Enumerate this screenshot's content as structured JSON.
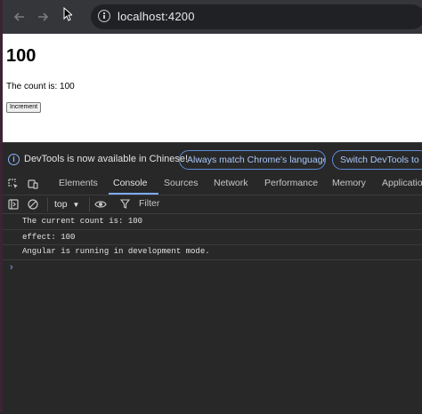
{
  "browser": {
    "back_icon": "arrow-left-icon",
    "forward_icon": "arrow-right-icon",
    "address": "localhost:4200"
  },
  "page": {
    "heading": "100",
    "count_text": "The count is: 100",
    "button_label": "Increment"
  },
  "devtools": {
    "info_text": "DevTools is now available in Chinese!",
    "match_language_label": "Always match Chrome's language",
    "switch_label": "Switch DevTools to C",
    "tabs": [
      {
        "label": "Elements"
      },
      {
        "label": "Console"
      },
      {
        "label": "Sources"
      },
      {
        "label": "Network"
      },
      {
        "label": "Performance"
      },
      {
        "label": "Memory"
      },
      {
        "label": "Applicatio"
      }
    ],
    "context": "top",
    "filter_placeholder": "Filter",
    "logs": [
      "The current count is: 100",
      "effect: 100",
      "Angular is running in development mode."
    ],
    "prompt": "›",
    "accent": "#7cacf8"
  }
}
